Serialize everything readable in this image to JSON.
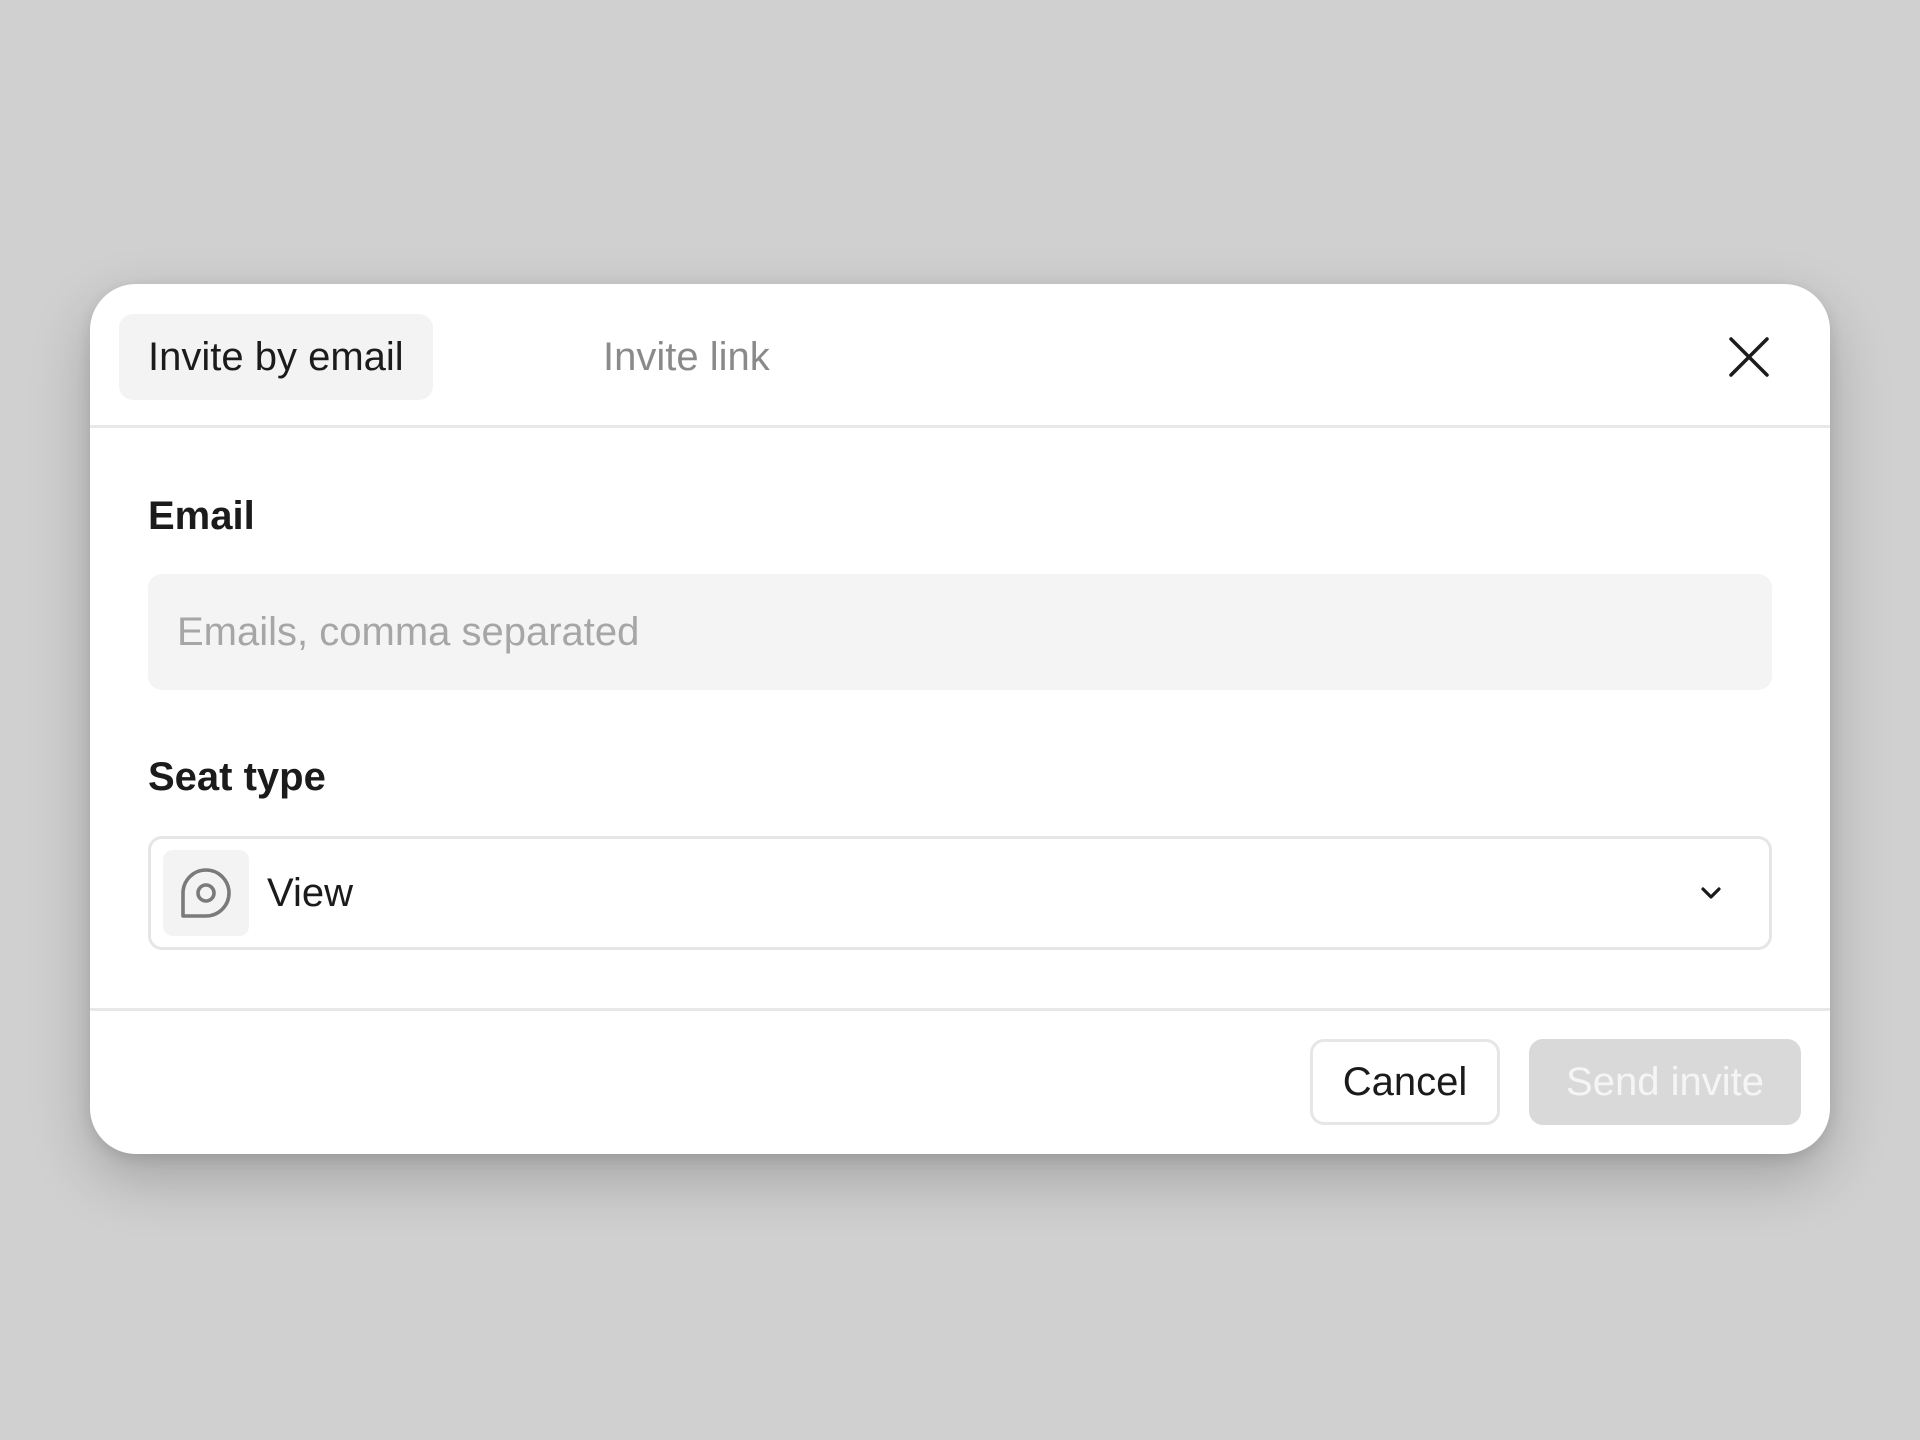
{
  "tabs": [
    {
      "label": "Invite by email",
      "active": true
    },
    {
      "label": "Invite link",
      "active": false
    }
  ],
  "email": {
    "label": "Email",
    "placeholder": "Emails, comma separated",
    "value": ""
  },
  "seat_type": {
    "label": "Seat type",
    "selected": "View",
    "icon": "location-pin-icon"
  },
  "footer": {
    "cancel_label": "Cancel",
    "send_label": "Send invite"
  },
  "colors": {
    "backdrop": "#d0d0d0",
    "surface": "#ffffff",
    "active_tab_bg": "#f3f3f3",
    "input_bg": "#f4f4f4",
    "disabled_button_bg": "#d9d9d9"
  }
}
